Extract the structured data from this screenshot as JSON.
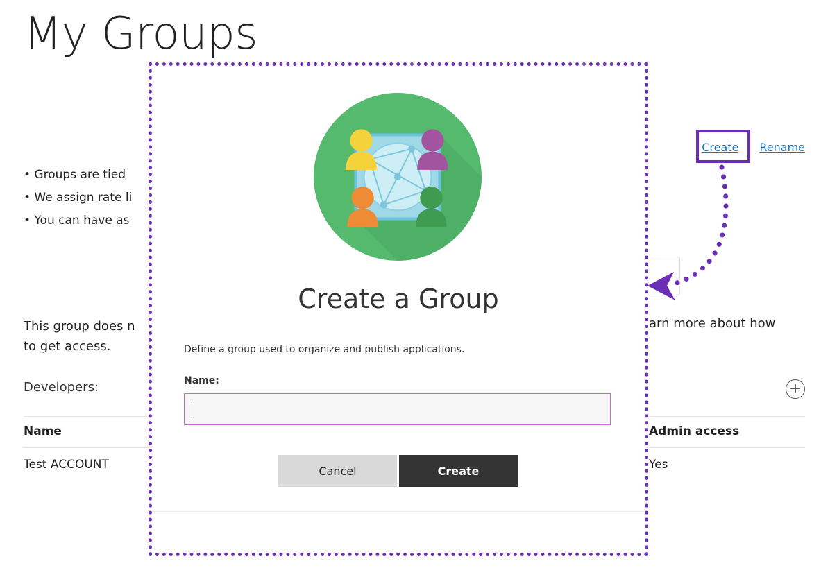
{
  "page": {
    "title": "My Groups",
    "links": {
      "create": "Create",
      "rename": "Rename"
    },
    "bullets": [
      "• Groups are tied",
      "• We assign rate li",
      "• You can have as"
    ],
    "notice": {
      "line1": "This group does n",
      "line2": "to get access.",
      "right": "arn more about how"
    },
    "developers_label": "Developers:",
    "add_symbol": "+",
    "table": {
      "headers": {
        "name": "Name",
        "admin": "Admin access"
      },
      "rows": [
        {
          "name": "Test ACCOUNT",
          "admin": "Yes"
        }
      ]
    }
  },
  "modal": {
    "title": "Create a Group",
    "description": "Define a group used to organize and publish applications.",
    "name_label": "Name:",
    "name_value": "",
    "cancel_label": "Cancel",
    "create_label": "Create"
  },
  "colors": {
    "highlight": "#6a2fb5",
    "link": "#1a73b8",
    "primary_button": "#333333",
    "secondary_button": "#d9d9d9",
    "logo_circle": "#55b96e"
  }
}
